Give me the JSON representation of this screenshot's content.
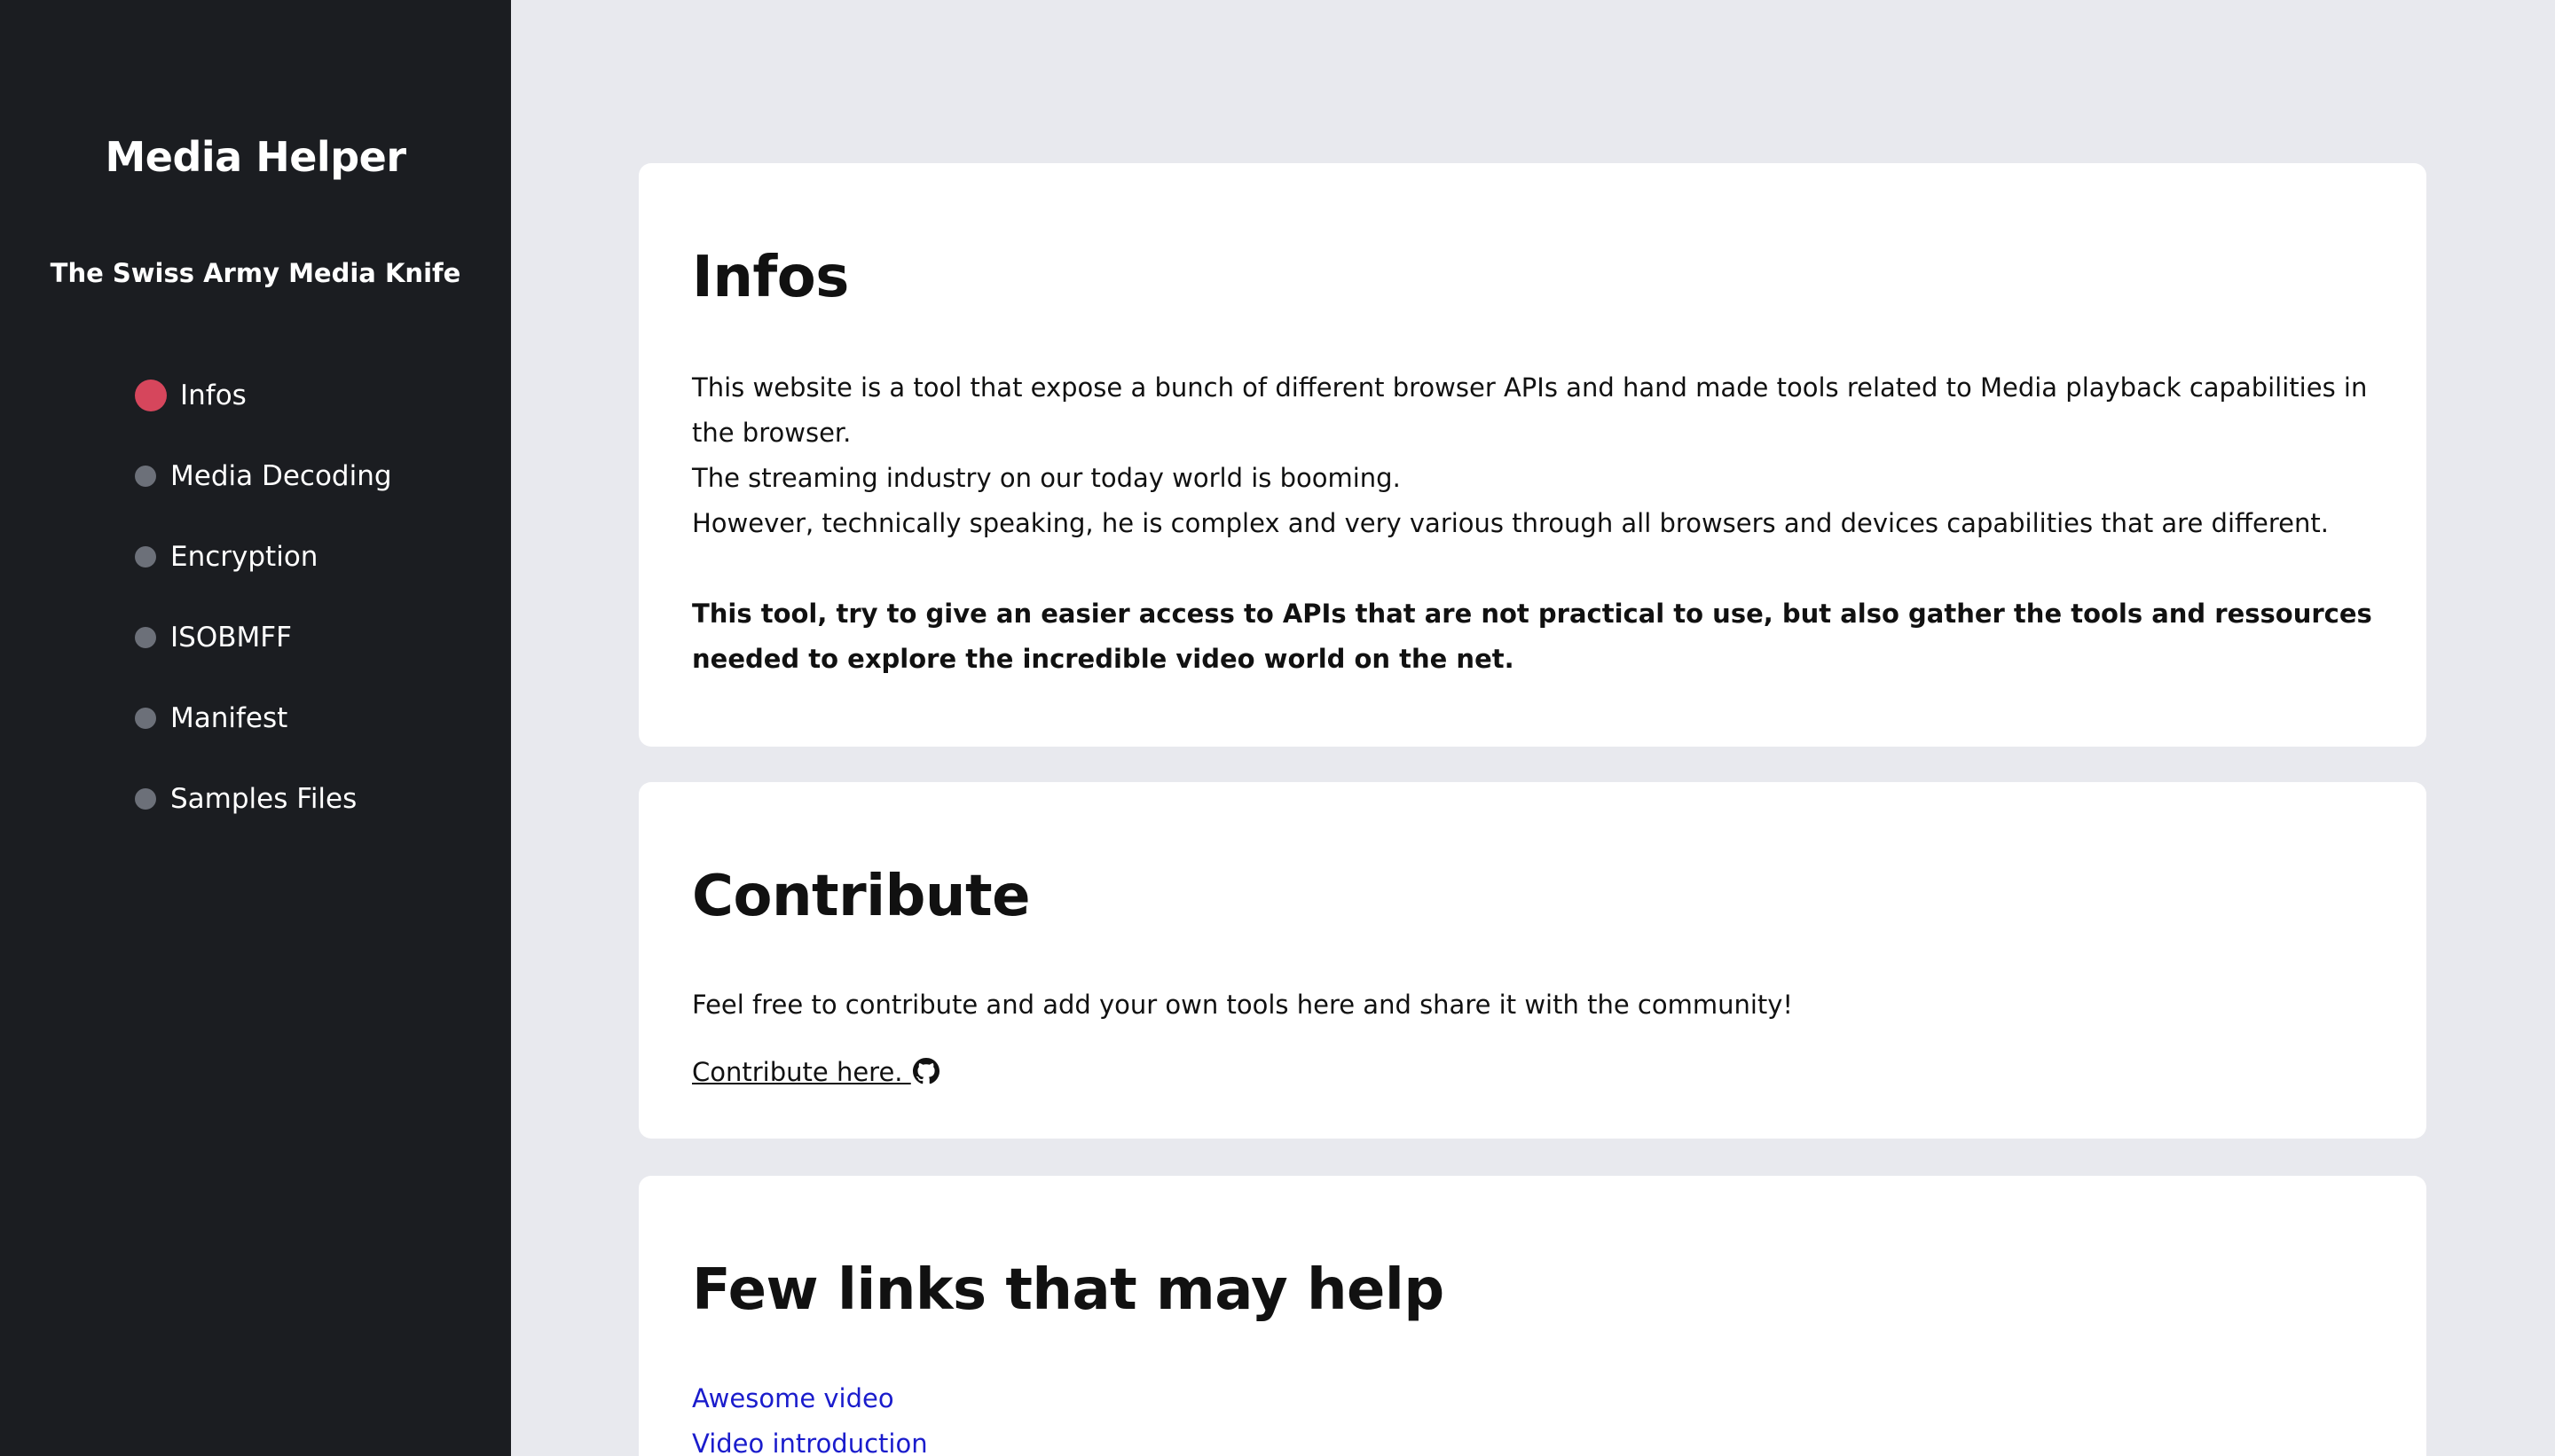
{
  "sidebar": {
    "title": "Media Helper",
    "subtitle": "The Swiss Army Media Knife",
    "items": [
      {
        "label": "Infos",
        "active": true
      },
      {
        "label": "Media Decoding",
        "active": false
      },
      {
        "label": "Encryption",
        "active": false
      },
      {
        "label": "ISOBMFF",
        "active": false
      },
      {
        "label": "Manifest",
        "active": false
      },
      {
        "label": "Samples Files",
        "active": false
      }
    ]
  },
  "infos": {
    "title": "Infos",
    "lines": [
      "This website is a tool that expose a bunch of different browser APIs and hand made tools related to Media playback capabilities in the browser.",
      "The streaming industry on our today world is booming.",
      "However, technically speaking, he is complex and very various through all browsers and devices capabilities that are different."
    ],
    "bold_text": "This tool, try to give an easier access to APIs that are not practical to use, but also gather the tools and ressources needed to explore the incredible video world on the net."
  },
  "contribute": {
    "title": "Contribute",
    "text": "Feel free to contribute and add your own tools here and share it with the community!",
    "link_label": "Contribute here. ",
    "link_icon": "github-icon"
  },
  "links": {
    "title": "Few links that may help",
    "items": [
      "Awesome video",
      "Video introduction"
    ]
  },
  "colors": {
    "sidebar_bg": "#1b1d21",
    "page_bg": "#e8e9ee",
    "active_dot": "#d6465c",
    "inactive_dot": "#6c7079",
    "link": "#1a1ccc"
  }
}
